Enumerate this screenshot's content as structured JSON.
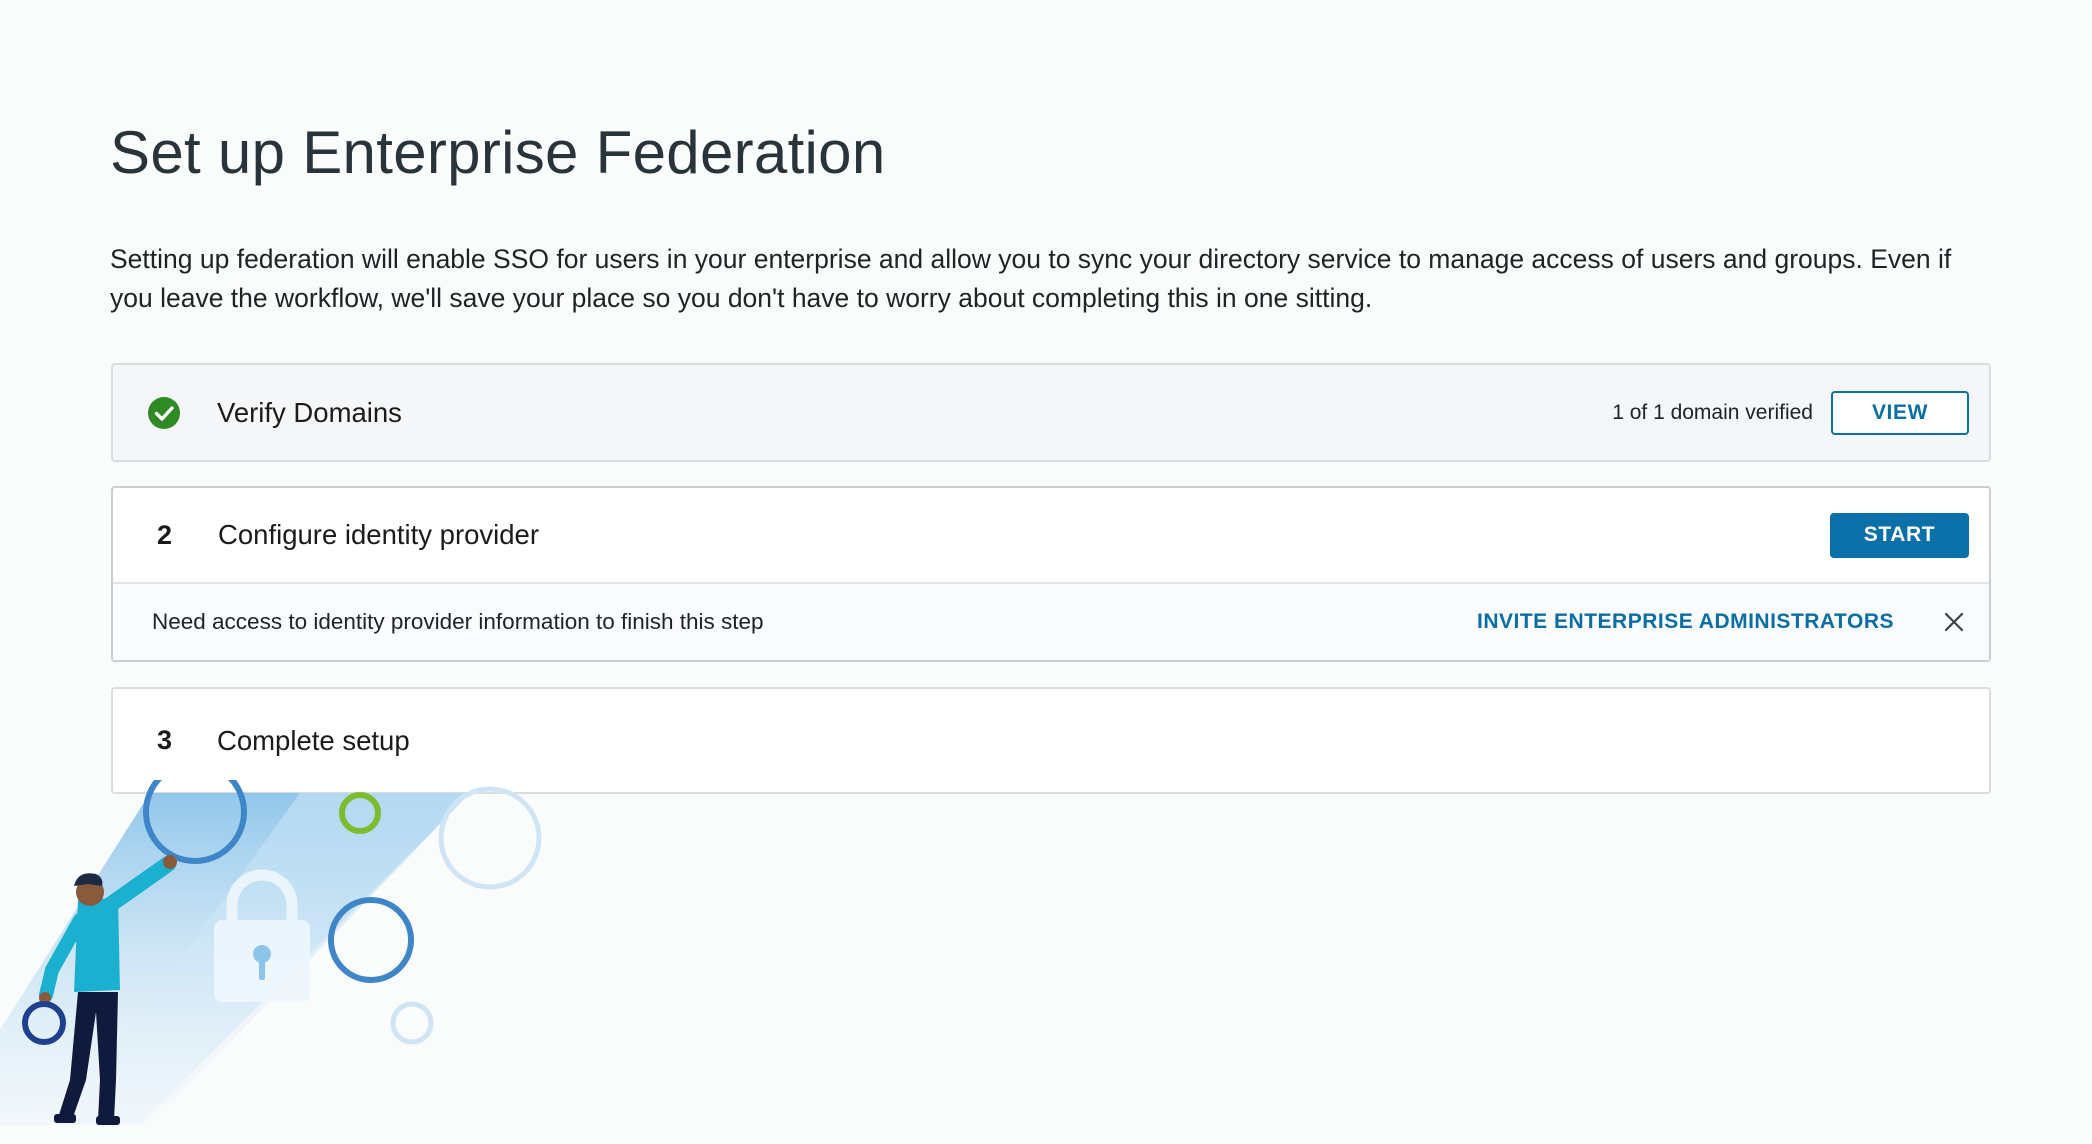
{
  "page": {
    "title": "Set up Enterprise Federation",
    "intro": "Setting up federation will enable SSO for users in your enterprise and allow you to sync your directory service to manage access of users and groups. Even if you leave the workflow, we'll save your place so you don't have to worry about completing this in one sitting."
  },
  "steps": [
    {
      "status": "completed",
      "icon": "check-circle-icon",
      "title": "Verify Domains",
      "meta": "1 of 1 domain verified",
      "action_label": "VIEW"
    },
    {
      "number": "2",
      "title": "Configure identity provider",
      "action_label": "START",
      "notice": {
        "text": "Need access to identity provider information to finish this step",
        "link_label": "INVITE ENTERPRISE ADMINISTRATORS",
        "close_icon": "close-icon"
      }
    },
    {
      "number": "3",
      "title": "Complete setup"
    }
  ],
  "colors": {
    "accent": "#0b6fa8",
    "success": "#2e8a22",
    "title": "#29343a"
  }
}
